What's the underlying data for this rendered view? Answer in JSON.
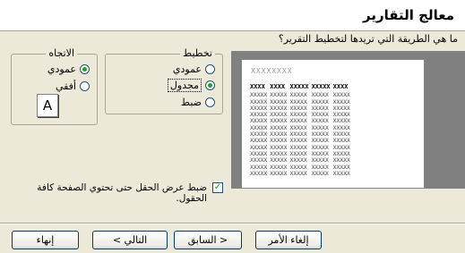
{
  "window": {
    "title": "معالج التقارير"
  },
  "question": "ما هي الطريقة التي تريدها لتخطيط التقرير؟",
  "layout_group": {
    "legend": "تخطيط",
    "options": [
      {
        "label": "عمودي",
        "selected": false
      },
      {
        "label": "مجدول",
        "selected": true
      },
      {
        "label": "ضبط",
        "selected": false
      }
    ]
  },
  "orientation_group": {
    "legend": "الاتجاه",
    "options": [
      {
        "label": "عمودي",
        "selected": true
      },
      {
        "label": "أفقي",
        "selected": false
      }
    ],
    "icon_letter": "A"
  },
  "preview": {
    "title": "XXXXXXXX",
    "header_row": [
      "XXXX",
      "XXXX",
      "XXXXX",
      "XXXXX",
      "XXXX"
    ],
    "cell": "XXXXX"
  },
  "fit_fields": {
    "label": "ضبط عرض الحقل حتى تحتوي الصفحة كافة الحقول.",
    "checked": true
  },
  "buttons": {
    "cancel": "إلغاء الأمر",
    "back": "< السابق",
    "next": "التالي >",
    "finish": "إنهاء"
  }
}
